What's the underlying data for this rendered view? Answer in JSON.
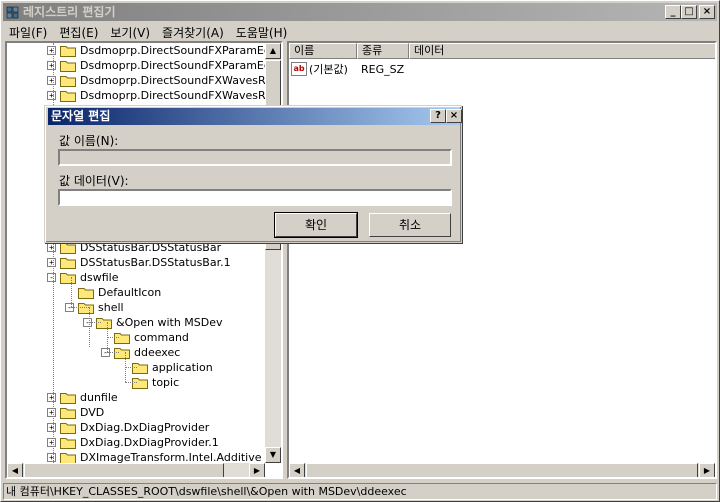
{
  "window": {
    "title": "레지스트리 편집기"
  },
  "title_buttons": {
    "minimize": "_",
    "maximize": "□",
    "close": "×"
  },
  "menu": [
    "파일(F)",
    "편집(E)",
    "보기(V)",
    "즐겨찾기(A)",
    "도움말(H)"
  ],
  "tree": [
    {
      "label": "Dsdmoprp.DirectSoundFXParamEqPa",
      "expander": "+"
    },
    {
      "label": "Dsdmoprp.DirectSoundFXParamEqPa",
      "expander": "+"
    },
    {
      "label": "Dsdmoprp.DirectSoundFXWavesRev",
      "expander": "+"
    },
    {
      "label": "Dsdmoprp.DirectSoundFXWavesRev",
      "expander": "+"
    },
    {
      "label": "DSStatusBar.DSStatusBar",
      "expander": "+"
    },
    {
      "label": "DSStatusBar.DSStatusBar.1",
      "expander": "+"
    },
    {
      "label": "dswfile",
      "expander": "-"
    },
    {
      "label": "DefaultIcon",
      "expander": ""
    },
    {
      "label": "shell",
      "expander": "-"
    },
    {
      "label": "&Open with MSDev",
      "expander": "-"
    },
    {
      "label": "command",
      "expander": ""
    },
    {
      "label": "ddeexec",
      "expander": "-"
    },
    {
      "label": "application",
      "expander": ""
    },
    {
      "label": "topic",
      "expander": ""
    },
    {
      "label": "dunfile",
      "expander": "+"
    },
    {
      "label": "DVD",
      "expander": "+"
    },
    {
      "label": "DxDiag.DxDiagProvider",
      "expander": "+"
    },
    {
      "label": "DxDiag.DxDiagProvider.1",
      "expander": "+"
    },
    {
      "label": "DXImageTransform.Intel.Additive",
      "expander": "+"
    }
  ],
  "list": {
    "headers": [
      "이름",
      "종류",
      "데이터"
    ],
    "rows": [
      {
        "name": "(기본값)",
        "type": "REG_SZ",
        "data": ""
      }
    ],
    "icon": "ab"
  },
  "dialog": {
    "title": "문자열 편집",
    "help_label": "?",
    "close_label": "×",
    "name_label": "값 이름(N):",
    "name_value": "",
    "data_label": "값 데이터(V):",
    "data_value": "",
    "ok_label": "확인",
    "cancel_label": "취소"
  },
  "scroll_arrows": {
    "up": "▲",
    "down": "▼",
    "left": "◀",
    "right": "▶"
  },
  "status": "내 컴퓨터\\HKEY_CLASSES_ROOT\\dswfile\\shell\\&Open with MSDev\\ddeexec"
}
